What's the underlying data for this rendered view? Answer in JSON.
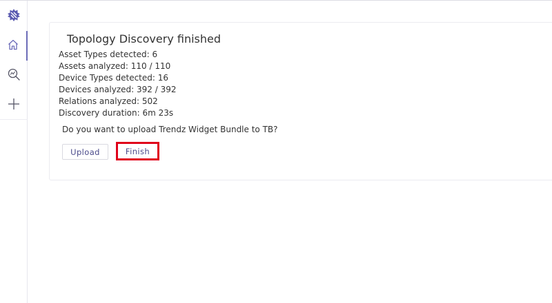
{
  "colors": {
    "accent": "#6b6bb8",
    "highlight_border": "#e0001a",
    "button_text": "#4a4a8a"
  },
  "sidebar": {
    "logo_icon": "trendz-gear-logo-icon",
    "items": [
      {
        "name": "home",
        "icon": "home-icon",
        "active": true
      },
      {
        "name": "discovery",
        "icon": "search-analytics-icon",
        "active": false
      },
      {
        "name": "add",
        "icon": "plus-icon",
        "active": false
      }
    ]
  },
  "panel": {
    "title": "Topology Discovery finished",
    "stats": [
      "Asset Types detected: 6",
      "Assets analyzed: 110 / 110",
      "Device Types detected: 16",
      "Devices analyzed: 392 / 392",
      "Relations analyzed: 502",
      "Discovery duration: 6m 23s"
    ],
    "question": "Do you want to upload Trendz Widget Bundle to TB?",
    "upload_label": "Upload",
    "finish_label": "Finish"
  }
}
